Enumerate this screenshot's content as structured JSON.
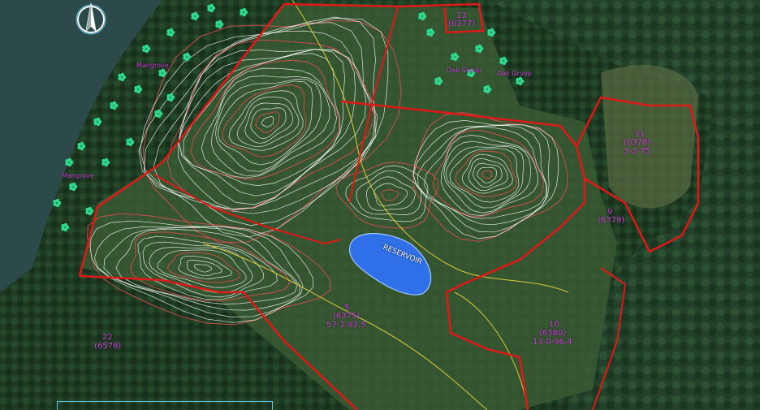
{
  "map": {
    "background_color": "#1f3320",
    "boundary_color": "#e01818",
    "contour_color": "#ffffff",
    "reservoir_color": "#2f6fe8",
    "label_color": "#c83dd6",
    "vegetation_color": "#2fd88e",
    "north_arrow": "north-arrow-icon"
  },
  "labels": {
    "mangrove_1": "Mangrove",
    "mangrove_2": "Mangrove",
    "oak_group_1": "Oak Group",
    "oak_group_2": "Oak Group",
    "reservoir": "RESERVOIR",
    "lot_22_num": "22",
    "lot_22_id": "(6578)",
    "lot_11_num": "11",
    "lot_11_id": "(6378)",
    "lot_11_area": "3-2-75",
    "lot_9_num": "9",
    "lot_9_id": "(6379)",
    "lot_10_num": "10",
    "lot_10_id": "(6380)",
    "lot_10_area": "13-0-96.4",
    "lot_center_num": "5",
    "lot_center_id": "(6375)",
    "lot_center_area": "57-2-92.5",
    "lot_top_num": "13",
    "lot_top_id": "(6377)"
  }
}
